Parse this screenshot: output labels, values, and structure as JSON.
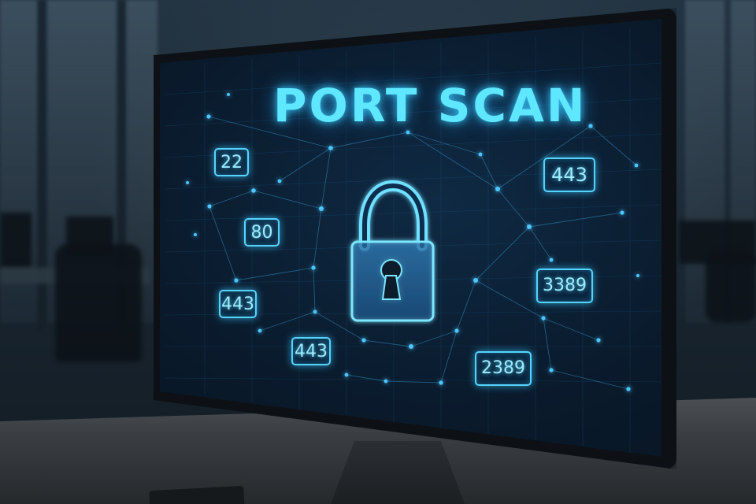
{
  "screen": {
    "title": "PORT SCAN",
    "ports": [
      "22",
      "80",
      "443",
      "443",
      "443",
      "3389",
      "2389"
    ],
    "lock_icon": "padlock-icon",
    "accent_color": "#5ee7ff"
  }
}
